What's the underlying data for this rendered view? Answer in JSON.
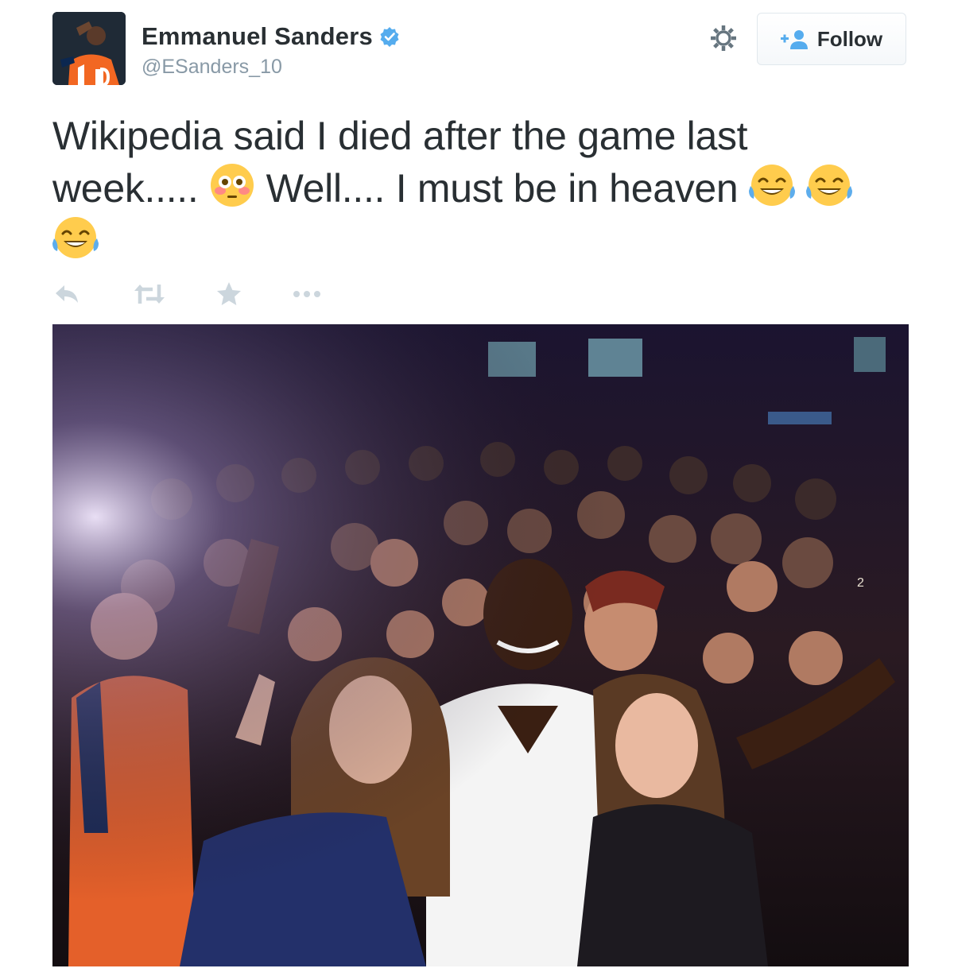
{
  "user": {
    "display_name": "Emmanuel Sanders",
    "handle": "@ESanders_10",
    "verified": true
  },
  "header": {
    "follow_label": "Follow",
    "settings_icon": "gear-icon"
  },
  "tweet": {
    "lines": [
      {
        "text": "Wikipedia said I died after the game last"
      },
      {
        "text_before": "week..... ",
        "emoji_1": "flushed-face",
        "text_after": " Well.... I must be in heaven "
      },
      {
        "emoji": "face-with-tears-of-joy"
      }
    ]
  },
  "actions": [
    {
      "name": "reply",
      "icon": "reply-icon"
    },
    {
      "name": "retweet",
      "icon": "retweet-icon"
    },
    {
      "name": "favorite",
      "icon": "star-icon"
    },
    {
      "name": "more",
      "icon": "more-icon"
    }
  ],
  "colors": {
    "text": "#292f33",
    "muted": "#8899a6",
    "verified_blue": "#55acee",
    "action_gray": "#ccd6dd",
    "border": "#e1e8ed"
  },
  "photo": {
    "description_icon": "crowd-selfie-photo"
  }
}
